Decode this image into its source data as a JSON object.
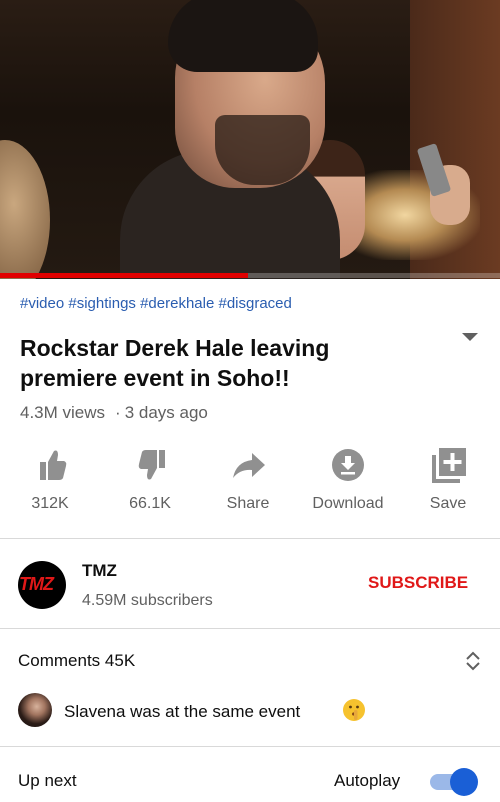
{
  "video": {
    "progress_percent": 49.6,
    "progress_color": "#e00000"
  },
  "details": {
    "hashtags": "#video #sightings #derekhale #disgraced",
    "title": "Rockstar Derek Hale leaving premiere event in Soho!!",
    "views": "4.3M views",
    "separator": "·",
    "age": "3 days ago"
  },
  "actions": [
    {
      "icon": "thumbs-up-icon",
      "label": "312K"
    },
    {
      "icon": "thumbs-down-icon",
      "label": "66.1K"
    },
    {
      "icon": "share-icon",
      "label": "Share"
    },
    {
      "icon": "download-icon",
      "label": "Download"
    },
    {
      "icon": "save-to-playlist-icon",
      "label": "Save"
    }
  ],
  "channel": {
    "avatar_text": "TMZ",
    "name": "TMZ",
    "subscribers": "4.59M subscribers",
    "subscribe_label": "SUBSCRIBE",
    "accent": "#e01818"
  },
  "comments": {
    "title": "Comments 45K",
    "top_comment": {
      "text": "Slavena was at the same event",
      "emoji": "shushing-face-emoji"
    }
  },
  "up_next": {
    "label": "Up next",
    "autoplay_label": "Autoplay",
    "autoplay_on": true,
    "toggle_color": "#1a5fd6"
  }
}
